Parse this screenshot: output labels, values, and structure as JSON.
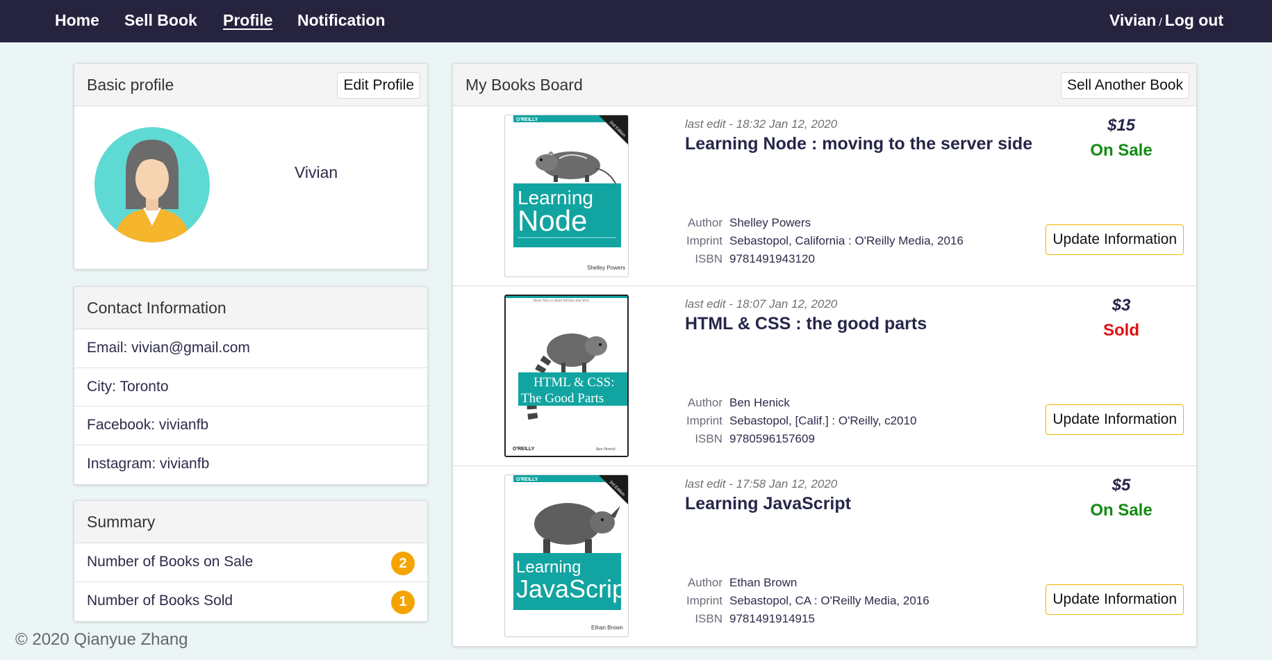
{
  "nav": {
    "home": "Home",
    "sell": "Sell Book",
    "profile": "Profile",
    "notification": "Notification",
    "user": "Vivian",
    "sep": "/",
    "logout": "Log out"
  },
  "basic_profile": {
    "title": "Basic profile",
    "edit_label": "Edit Profile",
    "name": "Vivian",
    "avatar_icon": "female-avatar-icon"
  },
  "contact": {
    "title": "Contact Information",
    "email": "Email: vivian@gmail.com",
    "city": "City: Toronto",
    "facebook": "Facebook: vivianfb",
    "instagram": "Instagram: vivianfb"
  },
  "summary": {
    "title": "Summary",
    "on_sale_label": "Number of Books on Sale",
    "on_sale_count": "2",
    "sold_label": "Number of Books Sold",
    "sold_count": "1"
  },
  "board": {
    "title": "My Books Board",
    "sell_another": "Sell Another Book",
    "update_label": "Update Information",
    "author_key": "Author",
    "imprint_key": "Imprint",
    "isbn_key": "ISBN",
    "books": [
      {
        "edited": "last edit - 18:32 Jan 12, 2020",
        "title": "Learning Node : moving to the server side",
        "price": "$15",
        "status": "On Sale",
        "status_color": "#138a13",
        "author": "Shelley Powers",
        "imprint": "Sebastopol, California : O'Reilly Media, 2016",
        "isbn": "9781491943120",
        "cover": {
          "publisher": "O'REILLY",
          "line1": "Learning",
          "line2": "Node",
          "byline": "Shelley Powers",
          "edition": "2nd Edition",
          "animal": "hamster"
        }
      },
      {
        "edited": "last edit - 18:07 Jan 12, 2020",
        "title": "HTML & CSS : the good parts",
        "price": "$3",
        "status": "Sold",
        "status_color": "#e01010",
        "author": "Ben Henick",
        "imprint": "Sebastopol, [Calif.] : O'Reilly, c2010",
        "isbn": "9780596157609",
        "cover": {
          "publisher": "O'REILLY",
          "tagline": "Better Ways to Build Websites that Work",
          "line1": "HTML & CSS:",
          "line2": "The Good Parts",
          "byline": "Ben Henick",
          "animal": "ringtail"
        }
      },
      {
        "edited": "last edit - 17:58 Jan 12, 2020",
        "title": "Learning JavaScript",
        "price": "$5",
        "status": "On Sale",
        "status_color": "#138a13",
        "author": "Ethan Brown",
        "imprint": "Sebastopol, CA : O'Reilly Media, 2016",
        "isbn": "9781491914915",
        "cover": {
          "publisher": "O'REILLY",
          "line1": "Learning",
          "line2": "JavaScript",
          "byline": "Ethan Brown",
          "edition": "3rd Edition",
          "animal": "rhinoceros"
        }
      }
    ]
  },
  "footer": "© 2020 Qianyue Zhang"
}
